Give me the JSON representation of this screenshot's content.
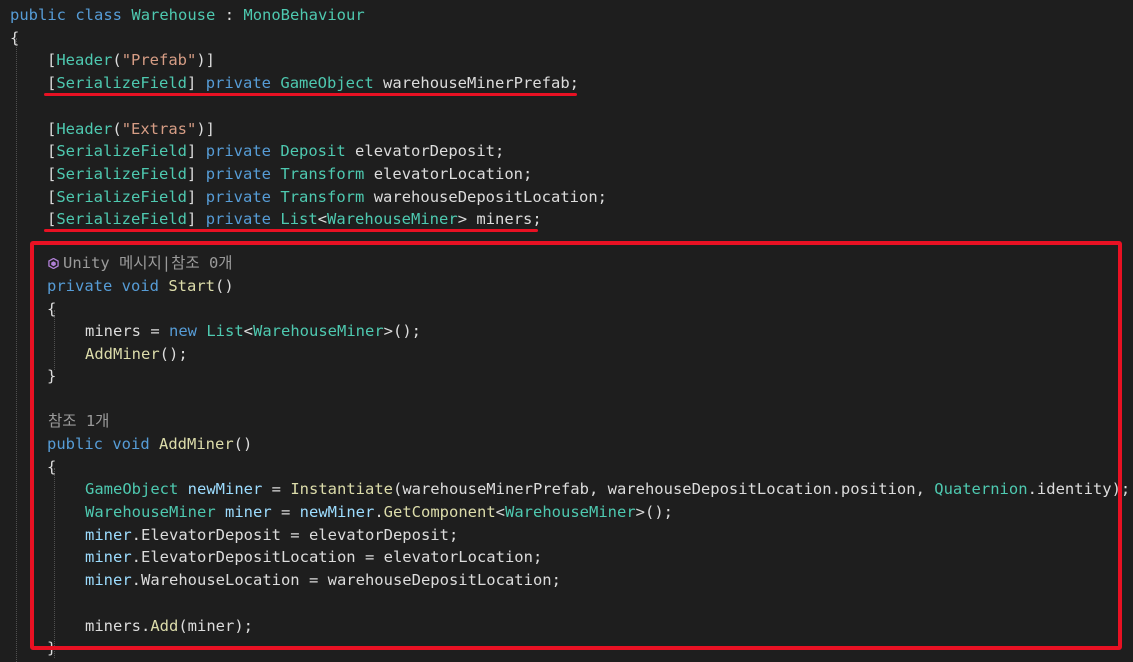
{
  "code": {
    "class_decl": {
      "kw1": "public",
      "kw2": "class",
      "name": "Warehouse",
      "sep": " : ",
      "base": "MonoBehaviour"
    },
    "open_brace": "{",
    "header_prefab": {
      "open": "[",
      "attr": "Header",
      "paren_open": "(",
      "str": "\"Prefab\"",
      "close": ")]"
    },
    "field_prefab": {
      "attr": "SerializeField",
      "access": "private",
      "type": "GameObject",
      "name": "warehouseMinerPrefab"
    },
    "header_extras": {
      "open": "[",
      "attr": "Header",
      "paren_open": "(",
      "str": "\"Extras\"",
      "close": ")]"
    },
    "field_deposit": {
      "attr": "SerializeField",
      "access": "private",
      "type": "Deposit",
      "name": "elevatorDeposit"
    },
    "field_elev_loc": {
      "attr": "SerializeField",
      "access": "private",
      "type": "Transform",
      "name": "elevatorLocation"
    },
    "field_wh_loc": {
      "attr": "SerializeField",
      "access": "private",
      "type": "Transform",
      "name": "warehouseDepositLocation"
    },
    "field_miners": {
      "attr": "SerializeField",
      "access": "private",
      "type": "List",
      "generic": "WarehouseMiner",
      "name": "miners"
    },
    "codelens_start": "Unity 메시지|참조 0개",
    "start_decl": {
      "access": "private",
      "ret": "void",
      "name": "Start",
      "parens": "()"
    },
    "start_body": {
      "miners_var": "miners",
      "assign": " = ",
      "new_kw": "new",
      "list_type": "List",
      "generic": "WarehouseMiner",
      "tail": ">();",
      "add_call": "AddMiner",
      "add_tail": "();"
    },
    "codelens_addminer": "참조 1개",
    "addminer_decl": {
      "access": "public",
      "ret": "void",
      "name": "AddMiner",
      "parens": "()"
    },
    "addminer_body": {
      "l1": {
        "type": "GameObject",
        "var": "newMiner",
        "assign": " = ",
        "fn": "Instantiate",
        "args1": "(warehouseMinerPrefab, warehouseDepositLocation.position, ",
        "quat": "Quaternion",
        "dot": ".",
        "identity": "identity",
        "end": ");"
      },
      "l2": {
        "type": "WarehouseMiner",
        "var": "miner",
        "assign": " = ",
        "obj": "newMiner",
        "dot": ".",
        "fn": "GetComponent",
        "generic": "WarehouseMiner",
        "end": ">();"
      },
      "l3": {
        "obj": "miner",
        "rest": ".ElevatorDeposit = elevatorDeposit;"
      },
      "l4": {
        "obj": "miner",
        "rest": ".ElevatorDepositLocation = elevatorLocation;"
      },
      "l5": {
        "obj": "miner",
        "rest": ".WarehouseLocation = warehouseDepositLocation;"
      },
      "l6": {
        "obj": "miners",
        "dot": ".",
        "fn": "Add",
        "args": "(miner);"
      }
    },
    "brace_open": "{",
    "brace_close": "}"
  },
  "colors": {
    "annotation_red": "#e81123",
    "keyword": "#569cd6",
    "type": "#4ec9b0",
    "string": "#d69d85",
    "method": "#dcdcaa"
  }
}
